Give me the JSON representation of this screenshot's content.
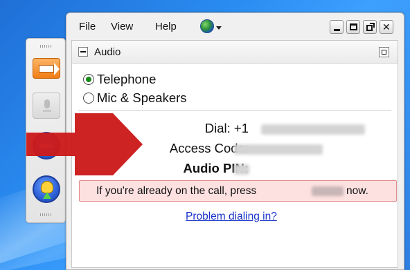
{
  "menu": {
    "file": "File",
    "view": "View",
    "help": "Help"
  },
  "window_buttons": [
    "minimize-icon",
    "maximize-icon",
    "popout-icon",
    "close-icon"
  ],
  "close_glyph": "✕",
  "audio": {
    "section_title": "Audio",
    "options": [
      {
        "label": "Telephone",
        "selected": true
      },
      {
        "label": "Mic & Speakers",
        "selected": false
      }
    ],
    "dial_label": "Dial: +1",
    "access_code_label": "Access Code:",
    "audio_pin_label": "Audio PIN:",
    "alert_prefix": "If you're already on the call, press",
    "alert_suffix": "now.",
    "link": "Problem dialing in?"
  },
  "colors": {
    "alert_bg": "#fde1e1",
    "alert_border": "#e58a8a",
    "link": "#1a33c9",
    "annotation_arrow": "#cc1a1a",
    "share_button": "#f07d16"
  },
  "icons": {
    "grabbar": [
      "share-arrow-icon",
      "microphone-icon",
      "minus-circle-icon",
      "raise-hand-icon"
    ],
    "menu": [
      "globe-icon"
    ]
  }
}
